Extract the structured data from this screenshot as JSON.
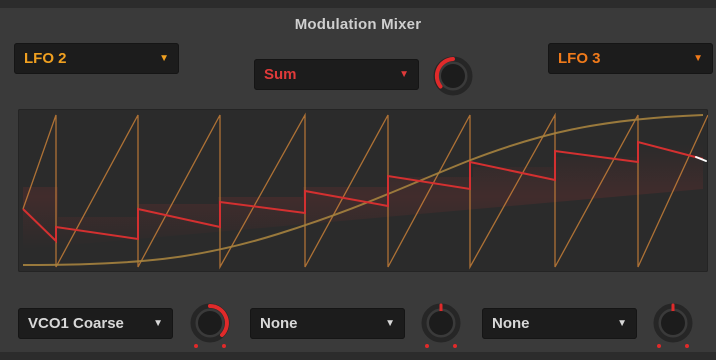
{
  "window": {
    "title": "Modulation Mixer"
  },
  "top_controls": {
    "left_source": {
      "value": "LFO 2",
      "color": "#f0a020"
    },
    "mode": {
      "value": "Sum",
      "color": "#e03a3a"
    },
    "right_source": {
      "value": "LFO 3",
      "color": "#f07a1a"
    },
    "mix_knob": {
      "accent": "#e02a2a"
    }
  },
  "waveforms": {
    "lfo2_color": "#d98a3a",
    "lfo3_color": "#a5823e",
    "sum_color": "#d43030"
  },
  "destinations": [
    {
      "value": "VCO1 Coarse",
      "icon": "chevron-down-icon",
      "knob_accent": "#e02a2a"
    },
    {
      "value": "None",
      "icon": "chevron-down-icon",
      "knob_accent": "#e02a2a"
    },
    {
      "value": "None",
      "icon": "chevron-down-icon",
      "knob_accent": "#e02a2a"
    }
  ],
  "arrows": {
    "dropdown_icon": "▼"
  }
}
